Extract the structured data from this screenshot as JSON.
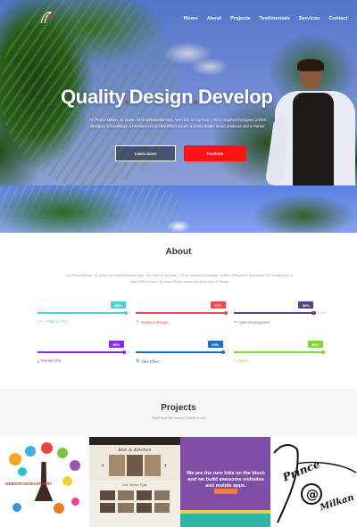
{
  "nav": {
    "items": [
      "Home",
      "About",
      "Projects",
      "Testimonials",
      "Services",
      "Contact"
    ]
  },
  "hero": {
    "title_words": [
      "Quality",
      "Design",
      "Develop"
    ],
    "subtitle": "I'm Prince Milkan, 21 years old small bearded man. Yes I live on my face :) I'm a Graphics Designer, a Web Designer & Developer, a Premiere pro & After Effect expert, a Home Studio music producer and a Painter",
    "learn_more_label": "Learn more",
    "portfolio_label": "Portfolio"
  },
  "about": {
    "title": "About",
    "text": "I'm Prince Milkan, 21 years old small bearded man. Yes I live on my face :) I'm a Graphics Designer, a Web Designer & Developer, a Premiere pro & After Effect expert, a Home Studio music producer and a Painter",
    "skills": [
      {
        "name": "HTML & CSS",
        "percent": "95%",
        "value": 95,
        "color": "#4fd1d6",
        "icon": "code-icon"
      },
      {
        "name": "Graphics Design",
        "percent": "97%",
        "value": 97,
        "color": "#f04a4a",
        "icon": "pencil-icon"
      },
      {
        "name": "Web Development",
        "percent": "86%",
        "value": 86,
        "color": "#5c3f86",
        "icon": "laptop-icon"
      },
      {
        "name": "Premire Pro",
        "percent": "93%",
        "value": 93,
        "color": "#8a2be2",
        "icon": "download-icon"
      },
      {
        "name": "After Effect",
        "percent": "94%",
        "value": 94,
        "color": "#1f6fc9",
        "icon": "gear-icon"
      },
      {
        "name": "Music",
        "percent": "96%",
        "value": 96,
        "color": "#7ad93a",
        "icon": "music-icon"
      }
    ]
  },
  "projects": {
    "title": "Projects",
    "subtitle": "You'll love My works. Check it out!",
    "items": [
      {
        "web_label": "WEBSITE DEVELOPMENT"
      },
      {
        "heading": "Bob & Kitchen",
        "subheading": "Our Menu Type"
      },
      {
        "headline": "We are the new kids on the block and we build awesome websites and mobile apps."
      },
      {
        "signature": "Prince Milkan"
      }
    ]
  },
  "colors": {
    "accent_red": "#ff1414",
    "title_dot": "#ff2a2a"
  }
}
